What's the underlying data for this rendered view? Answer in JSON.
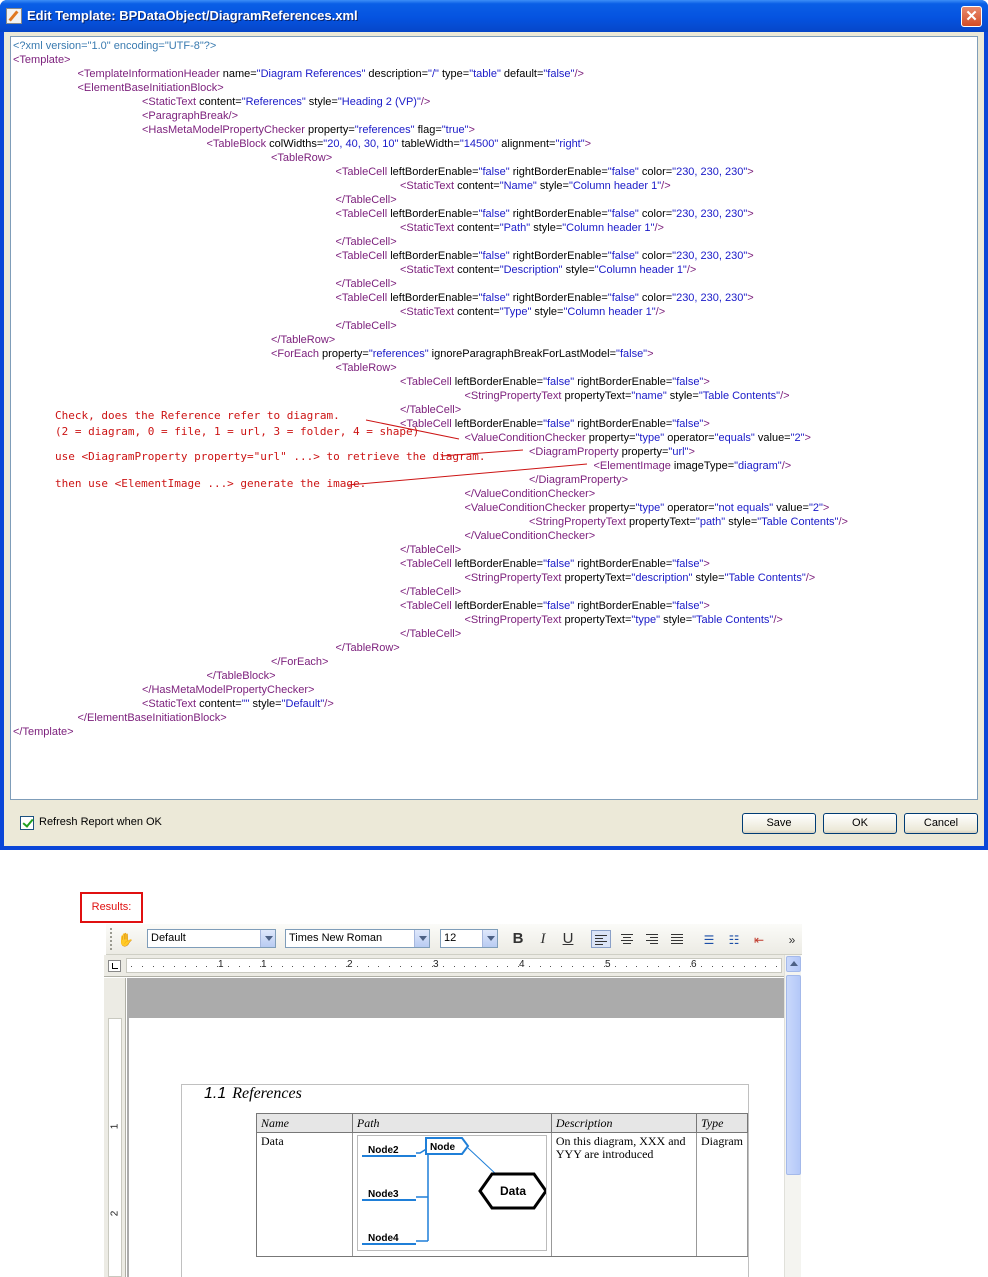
{
  "dialog": {
    "title": "Edit Template: BPDataObject/DiagramReferences.xml",
    "close_label": "✕",
    "refresh_label": "Refresh Report when OK",
    "refresh_checked": true,
    "buttons": {
      "save": "Save",
      "ok": "OK",
      "cancel": "Cancel"
    }
  },
  "xml_lines": [
    {
      "i": 0,
      "s": [
        [
          "pi",
          "<?xml version=\"1.0\" encoding=\"UTF-8\"?>"
        ]
      ]
    },
    {
      "i": 0,
      "s": [
        [
          "tag",
          "<Template>"
        ]
      ]
    },
    {
      "i": 1,
      "s": [
        [
          "tag",
          "<TemplateInformationHeader"
        ],
        [
          "attr",
          " name="
        ],
        [
          "val",
          "\"Diagram References\""
        ],
        [
          "attr",
          " description="
        ],
        [
          "val",
          "\"/\""
        ],
        [
          "attr",
          " type="
        ],
        [
          "val",
          "\"table\""
        ],
        [
          "attr",
          " default="
        ],
        [
          "val",
          "\"false\""
        ],
        [
          "tag",
          "/>"
        ]
      ]
    },
    {
      "i": 1,
      "s": [
        [
          "tag",
          "<ElementBaseInitiationBlock>"
        ]
      ]
    },
    {
      "i": 2,
      "s": [
        [
          "tag",
          "<StaticText"
        ],
        [
          "attr",
          " content="
        ],
        [
          "val",
          "\"References\""
        ],
        [
          "attr",
          " style="
        ],
        [
          "val",
          "\"Heading 2 (VP)\""
        ],
        [
          "tag",
          "/>"
        ]
      ]
    },
    {
      "i": 2,
      "s": [
        [
          "tag",
          "<ParagraphBreak/>"
        ]
      ]
    },
    {
      "i": 2,
      "s": [
        [
          "tag",
          "<HasMetaModelPropertyChecker"
        ],
        [
          "attr",
          " property="
        ],
        [
          "val",
          "\"references\""
        ],
        [
          "attr",
          " flag="
        ],
        [
          "val",
          "\"true\""
        ],
        [
          "tag",
          ">"
        ]
      ]
    },
    {
      "i": 3,
      "s": [
        [
          "tag",
          "<TableBlock"
        ],
        [
          "attr",
          " colWidths="
        ],
        [
          "val",
          "\"20, 40, 30, 10\""
        ],
        [
          "attr",
          " tableWidth="
        ],
        [
          "val",
          "\"14500\""
        ],
        [
          "attr",
          " alignment="
        ],
        [
          "val",
          "\"right\""
        ],
        [
          "tag",
          ">"
        ]
      ]
    },
    {
      "i": 4,
      "s": [
        [
          "tag",
          "<TableRow>"
        ]
      ]
    },
    {
      "i": 5,
      "s": [
        [
          "tag",
          "<TableCell"
        ],
        [
          "attr",
          " leftBorderEnable="
        ],
        [
          "val",
          "\"false\""
        ],
        [
          "attr",
          " rightBorderEnable="
        ],
        [
          "val",
          "\"false\""
        ],
        [
          "attr",
          " color="
        ],
        [
          "val",
          "\"230, 230, 230\""
        ],
        [
          "tag",
          ">"
        ]
      ]
    },
    {
      "i": 6,
      "s": [
        [
          "tag",
          "<StaticText"
        ],
        [
          "attr",
          " content="
        ],
        [
          "val",
          "\"Name\""
        ],
        [
          "attr",
          " style="
        ],
        [
          "val",
          "\"Column header 1\""
        ],
        [
          "tag",
          "/>"
        ]
      ]
    },
    {
      "i": 5,
      "s": [
        [
          "tag",
          "</TableCell>"
        ]
      ]
    },
    {
      "i": 5,
      "s": [
        [
          "tag",
          "<TableCell"
        ],
        [
          "attr",
          " leftBorderEnable="
        ],
        [
          "val",
          "\"false\""
        ],
        [
          "attr",
          " rightBorderEnable="
        ],
        [
          "val",
          "\"false\""
        ],
        [
          "attr",
          " color="
        ],
        [
          "val",
          "\"230, 230, 230\""
        ],
        [
          "tag",
          ">"
        ]
      ]
    },
    {
      "i": 6,
      "s": [
        [
          "tag",
          "<StaticText"
        ],
        [
          "attr",
          " content="
        ],
        [
          "val",
          "\"Path\""
        ],
        [
          "attr",
          " style="
        ],
        [
          "val",
          "\"Column header 1\""
        ],
        [
          "tag",
          "/>"
        ]
      ]
    },
    {
      "i": 5,
      "s": [
        [
          "tag",
          "</TableCell>"
        ]
      ]
    },
    {
      "i": 5,
      "s": [
        [
          "tag",
          "<TableCell"
        ],
        [
          "attr",
          " leftBorderEnable="
        ],
        [
          "val",
          "\"false\""
        ],
        [
          "attr",
          " rightBorderEnable="
        ],
        [
          "val",
          "\"false\""
        ],
        [
          "attr",
          " color="
        ],
        [
          "val",
          "\"230, 230, 230\""
        ],
        [
          "tag",
          ">"
        ]
      ]
    },
    {
      "i": 6,
      "s": [
        [
          "tag",
          "<StaticText"
        ],
        [
          "attr",
          " content="
        ],
        [
          "val",
          "\"Description\""
        ],
        [
          "attr",
          " style="
        ],
        [
          "val",
          "\"Column header 1\""
        ],
        [
          "tag",
          "/>"
        ]
      ]
    },
    {
      "i": 5,
      "s": [
        [
          "tag",
          "</TableCell>"
        ]
      ]
    },
    {
      "i": 5,
      "s": [
        [
          "tag",
          "<TableCell"
        ],
        [
          "attr",
          " leftBorderEnable="
        ],
        [
          "val",
          "\"false\""
        ],
        [
          "attr",
          " rightBorderEnable="
        ],
        [
          "val",
          "\"false\""
        ],
        [
          "attr",
          " color="
        ],
        [
          "val",
          "\"230, 230, 230\""
        ],
        [
          "tag",
          ">"
        ]
      ]
    },
    {
      "i": 6,
      "s": [
        [
          "tag",
          "<StaticText"
        ],
        [
          "attr",
          " content="
        ],
        [
          "val",
          "\"Type\""
        ],
        [
          "attr",
          " style="
        ],
        [
          "val",
          "\"Column header 1\""
        ],
        [
          "tag",
          "/>"
        ]
      ]
    },
    {
      "i": 5,
      "s": [
        [
          "tag",
          "</TableCell>"
        ]
      ]
    },
    {
      "i": 4,
      "s": [
        [
          "tag",
          "</TableRow>"
        ]
      ]
    },
    {
      "i": 4,
      "s": [
        [
          "tag",
          "<ForEach"
        ],
        [
          "attr",
          " property="
        ],
        [
          "val",
          "\"references\""
        ],
        [
          "attr",
          " ignoreParagraphBreakForLastModel="
        ],
        [
          "val",
          "\"false\""
        ],
        [
          "tag",
          ">"
        ]
      ]
    },
    {
      "i": 5,
      "s": [
        [
          "tag",
          "<TableRow>"
        ]
      ]
    },
    {
      "i": 6,
      "s": [
        [
          "tag",
          "<TableCell"
        ],
        [
          "attr",
          " leftBorderEnable="
        ],
        [
          "val",
          "\"false\""
        ],
        [
          "attr",
          " rightBorderEnable="
        ],
        [
          "val",
          "\"false\""
        ],
        [
          "tag",
          ">"
        ]
      ]
    },
    {
      "i": 7,
      "s": [
        [
          "tag",
          "<StringPropertyText"
        ],
        [
          "attr",
          " propertyText="
        ],
        [
          "val",
          "\"name\""
        ],
        [
          "attr",
          " style="
        ],
        [
          "val",
          "\"Table Contents\""
        ],
        [
          "tag",
          "/>"
        ]
      ]
    },
    {
      "i": 6,
      "s": [
        [
          "tag",
          "</TableCell>"
        ]
      ]
    },
    {
      "i": 6,
      "s": [
        [
          "tag",
          "<TableCell"
        ],
        [
          "attr",
          " leftBorderEnable="
        ],
        [
          "val",
          "\"false\""
        ],
        [
          "attr",
          " rightBorderEnable="
        ],
        [
          "val",
          "\"false\""
        ],
        [
          "tag",
          ">"
        ]
      ]
    },
    {
      "i": 7,
      "s": [
        [
          "tag",
          "<ValueConditionChecker"
        ],
        [
          "attr",
          " property="
        ],
        [
          "val",
          "\"type\""
        ],
        [
          "attr",
          " operator="
        ],
        [
          "val",
          "\"equals\""
        ],
        [
          "attr",
          " value="
        ],
        [
          "val",
          "\"2\""
        ],
        [
          "tag",
          ">"
        ]
      ]
    },
    {
      "i": 8,
      "s": [
        [
          "tag",
          "<DiagramProperty"
        ],
        [
          "attr",
          " property="
        ],
        [
          "val",
          "\"url\""
        ],
        [
          "tag",
          ">"
        ]
      ]
    },
    {
      "i": 9,
      "s": [
        [
          "tag",
          "<ElementImage"
        ],
        [
          "attr",
          " imageType="
        ],
        [
          "val",
          "\"diagram\""
        ],
        [
          "tag",
          "/>"
        ]
      ]
    },
    {
      "i": 8,
      "s": [
        [
          "tag",
          "</DiagramProperty>"
        ]
      ]
    },
    {
      "i": 7,
      "s": [
        [
          "tag",
          "</ValueConditionChecker>"
        ]
      ]
    },
    {
      "i": 7,
      "s": [
        [
          "tag",
          "<ValueConditionChecker"
        ],
        [
          "attr",
          " property="
        ],
        [
          "val",
          "\"type\""
        ],
        [
          "attr",
          " operator="
        ],
        [
          "val",
          "\"not equals\""
        ],
        [
          "attr",
          " value="
        ],
        [
          "val",
          "\"2\""
        ],
        [
          "tag",
          ">"
        ]
      ]
    },
    {
      "i": 8,
      "s": [
        [
          "tag",
          "<StringPropertyText"
        ],
        [
          "attr",
          " propertyText="
        ],
        [
          "val",
          "\"path\""
        ],
        [
          "attr",
          " style="
        ],
        [
          "val",
          "\"Table Contents\""
        ],
        [
          "tag",
          "/>"
        ]
      ]
    },
    {
      "i": 7,
      "s": [
        [
          "tag",
          "</ValueConditionChecker>"
        ]
      ]
    },
    {
      "i": 6,
      "s": [
        [
          "tag",
          "</TableCell>"
        ]
      ]
    },
    {
      "i": 6,
      "s": [
        [
          "tag",
          "<TableCell"
        ],
        [
          "attr",
          " leftBorderEnable="
        ],
        [
          "val",
          "\"false\""
        ],
        [
          "attr",
          " rightBorderEnable="
        ],
        [
          "val",
          "\"false\""
        ],
        [
          "tag",
          ">"
        ]
      ]
    },
    {
      "i": 7,
      "s": [
        [
          "tag",
          "<StringPropertyText"
        ],
        [
          "attr",
          " propertyText="
        ],
        [
          "val",
          "\"description\""
        ],
        [
          "attr",
          " style="
        ],
        [
          "val",
          "\"Table Contents\""
        ],
        [
          "tag",
          "/>"
        ]
      ]
    },
    {
      "i": 6,
      "s": [
        [
          "tag",
          "</TableCell>"
        ]
      ]
    },
    {
      "i": 6,
      "s": [
        [
          "tag",
          "<TableCell"
        ],
        [
          "attr",
          " leftBorderEnable="
        ],
        [
          "val",
          "\"false\""
        ],
        [
          "attr",
          " rightBorderEnable="
        ],
        [
          "val",
          "\"false\""
        ],
        [
          "tag",
          ">"
        ]
      ]
    },
    {
      "i": 7,
      "s": [
        [
          "tag",
          "<StringPropertyText"
        ],
        [
          "attr",
          " propertyText="
        ],
        [
          "val",
          "\"type\""
        ],
        [
          "attr",
          " style="
        ],
        [
          "val",
          "\"Table Contents\""
        ],
        [
          "tag",
          "/>"
        ]
      ]
    },
    {
      "i": 6,
      "s": [
        [
          "tag",
          "</TableCell>"
        ]
      ]
    },
    {
      "i": 5,
      "s": [
        [
          "tag",
          "</TableRow>"
        ]
      ]
    },
    {
      "i": 4,
      "s": [
        [
          "tag",
          "</ForEach>"
        ]
      ]
    },
    {
      "i": 3,
      "s": [
        [
          "tag",
          "</TableBlock>"
        ]
      ]
    },
    {
      "i": 2,
      "s": [
        [
          "tag",
          "</HasMetaModelPropertyChecker>"
        ]
      ]
    },
    {
      "i": 2,
      "s": [
        [
          "tag",
          "<StaticText"
        ],
        [
          "attr",
          " content="
        ],
        [
          "val",
          "\"\""
        ],
        [
          "attr",
          " style="
        ],
        [
          "val",
          "\"Default\""
        ],
        [
          "tag",
          "/>"
        ]
      ]
    },
    {
      "i": 1,
      "s": [
        [
          "tag",
          "</ElementBaseInitiationBlock>"
        ]
      ]
    },
    {
      "i": 0,
      "s": [
        [
          "tag",
          "</Template>"
        ]
      ]
    }
  ],
  "annotations": {
    "check": "Check, does the Reference refer to diagram.",
    "legend": "(2 = diagram, 0 = file, 1 = url, 3 = folder, 4 = shape)",
    "retrieve": "use <DiagramProperty property=\"url\" ...> to retrieve the diagram.",
    "generate": "then use <ElementImage ...> generate the image.",
    "color": "#cc1414"
  },
  "results": {
    "label": "Results:",
    "toolbar": {
      "style": "Default",
      "font": "Times New Roman",
      "size": "12",
      "bold": "B",
      "italic": "I",
      "underline": "U",
      "more": "»"
    },
    "ruler_numbers": [
      "1",
      "1",
      "2",
      "3",
      "4",
      "5",
      "6"
    ],
    "vruler_numbers": [
      "1",
      "2"
    ],
    "document": {
      "heading_number": "1.1",
      "heading_text": "References",
      "headers": [
        "Name",
        "Path",
        "Description",
        "Type"
      ],
      "row": {
        "name": "Data",
        "description": "On this diagram, XXX and YYY are introduced",
        "type": "Diagram"
      },
      "diagram": {
        "nodes": [
          "Node2",
          "Node3",
          "Node4"
        ],
        "center": "Node",
        "data": "Data",
        "line_color": "#1f7fd8"
      }
    }
  }
}
